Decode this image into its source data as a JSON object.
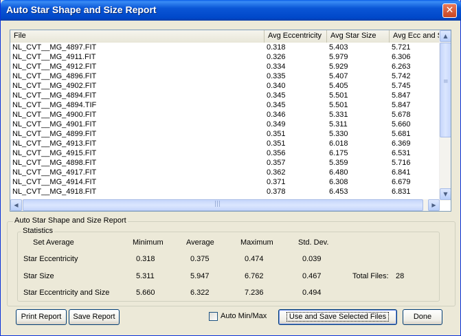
{
  "window": {
    "title": "Auto Star Shape and Size Report",
    "close_glyph": "✕"
  },
  "list": {
    "columns": [
      "File",
      "Avg Eccentricity",
      "Avg Star Size",
      "Avg Ecc and S"
    ],
    "rows": [
      [
        "NL_CVT__MG_4897.FIT",
        "0.318",
        "5.403",
        "5.721"
      ],
      [
        "NL_CVT__MG_4911.FIT",
        "0.326",
        "5.979",
        "6.306"
      ],
      [
        "NL_CVT__MG_4912.FIT",
        "0.334",
        "5.929",
        "6.263"
      ],
      [
        "NL_CVT__MG_4896.FIT",
        "0.335",
        "5.407",
        "5.742"
      ],
      [
        "NL_CVT__MG_4902.FIT",
        "0.340",
        "5.405",
        "5.745"
      ],
      [
        "NL_CVT__MG_4894.FIT",
        "0.345",
        "5.501",
        "5.847"
      ],
      [
        "NL_CVT__MG_4894.TIF",
        "0.345",
        "5.501",
        "5.847"
      ],
      [
        "NL_CVT__MG_4900.FIT",
        "0.346",
        "5.331",
        "5.678"
      ],
      [
        "NL_CVT__MG_4901.FIT",
        "0.349",
        "5.311",
        "5.660"
      ],
      [
        "NL_CVT__MG_4899.FIT",
        "0.351",
        "5.330",
        "5.681"
      ],
      [
        "NL_CVT__MG_4913.FIT",
        "0.351",
        "6.018",
        "6.369"
      ],
      [
        "NL_CVT__MG_4915.FIT",
        "0.356",
        "6.175",
        "6.531"
      ],
      [
        "NL_CVT__MG_4898.FIT",
        "0.357",
        "5.359",
        "5.716"
      ],
      [
        "NL_CVT__MG_4917.FIT",
        "0.362",
        "6.480",
        "6.841"
      ],
      [
        "NL_CVT__MG_4914.FIT",
        "0.371",
        "6.308",
        "6.679"
      ],
      [
        "NL_CVT__MG_4918.FIT",
        "0.378",
        "6.453",
        "6.831"
      ]
    ]
  },
  "report_group": {
    "label": "Auto Star Shape and Size Report"
  },
  "statistics": {
    "label": "Statistics",
    "headers": {
      "set_average": "Set Average",
      "minimum": "Minimum",
      "average": "Average",
      "maximum": "Maximum",
      "std_dev": "Std. Dev."
    },
    "rows": [
      {
        "name": "Star Eccentricity",
        "min": "0.318",
        "avg": "0.375",
        "max": "0.474",
        "std": "0.039"
      },
      {
        "name": "Star Size",
        "min": "5.311",
        "avg": "5.947",
        "max": "6.762",
        "std": "0.467"
      },
      {
        "name": "Star Eccentricity and Size",
        "min": "5.660",
        "avg": "6.322",
        "max": "7.236",
        "std": "0.494"
      }
    ],
    "total_files_label": "Total Files:",
    "total_files_value": "28"
  },
  "buttons": {
    "print_report": "Print Report",
    "save_report": "Save Report",
    "use_and_save": "Use and Save Selected Files",
    "done": "Done"
  },
  "auto_min_max": {
    "label": "Auto Min/Max",
    "checked": false
  },
  "colors": {
    "titlebar": "#0a56d6",
    "dialog_bg": "#ece9d8",
    "list_border": "#7f9db9"
  }
}
